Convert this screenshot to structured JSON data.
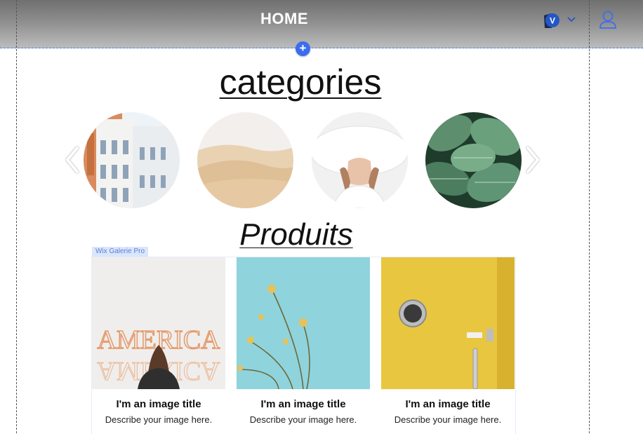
{
  "header": {
    "title": "HOME",
    "language_flag": "V"
  },
  "add_button": {
    "label": "+"
  },
  "categories": {
    "title": "categories",
    "items": [
      {
        "image": "building-photo"
      },
      {
        "image": "desert-photo"
      },
      {
        "image": "woman-hat-photo"
      },
      {
        "image": "leaves-photo"
      }
    ]
  },
  "produits": {
    "title": "Produits",
    "gallery_label": "Wix Galerie Pro",
    "items": [
      {
        "image": "america-sign-photo",
        "title": "I'm an image title",
        "description": "Describe your image here."
      },
      {
        "image": "flowers-sky-photo",
        "title": "I'm an image title",
        "description": "Describe your image here."
      },
      {
        "image": "yellow-door-photo",
        "title": "I'm an image title",
        "description": "Describe your image here."
      }
    ]
  },
  "colors": {
    "accent": "#3b6df0",
    "header_top": "#6f6f6f",
    "header_bottom": "#bdbdbd"
  },
  "icons": [
    "chevron-down-icon",
    "user-icon",
    "arrow-left-icon",
    "arrow-right-icon",
    "plus-icon"
  ]
}
